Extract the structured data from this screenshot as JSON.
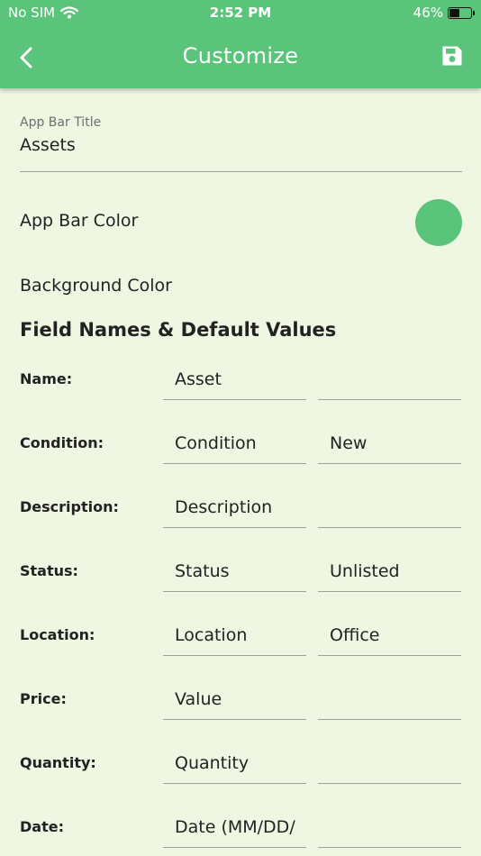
{
  "status_bar": {
    "carrier": "No SIM",
    "time": "2:52 PM",
    "battery": "46%",
    "battery_level": 0.46
  },
  "header": {
    "title": "Customize"
  },
  "form": {
    "app_bar_title": {
      "label": "App Bar Title",
      "value": "Assets"
    },
    "app_bar_color_label": "App Bar Color",
    "background_color_label": "Background Color",
    "section_title": "Field Names & Default Values"
  },
  "fields": [
    {
      "label": "Name:",
      "name": "Asset",
      "default": ""
    },
    {
      "label": "Condition:",
      "name": "Condition",
      "default": "New"
    },
    {
      "label": "Description:",
      "name": "Description",
      "default": ""
    },
    {
      "label": "Status:",
      "name": "Status",
      "default": "Unlisted"
    },
    {
      "label": "Location:",
      "name": "Location",
      "default": "Office"
    },
    {
      "label": "Price:",
      "name": "Value",
      "default": ""
    },
    {
      "label": "Quantity:",
      "name": "Quantity",
      "default": ""
    },
    {
      "label": "Date:",
      "name": "Date (MM/DD/",
      "default": ""
    }
  ],
  "colors": {
    "accent": "#5bc47b",
    "background": "#eff7e3"
  }
}
